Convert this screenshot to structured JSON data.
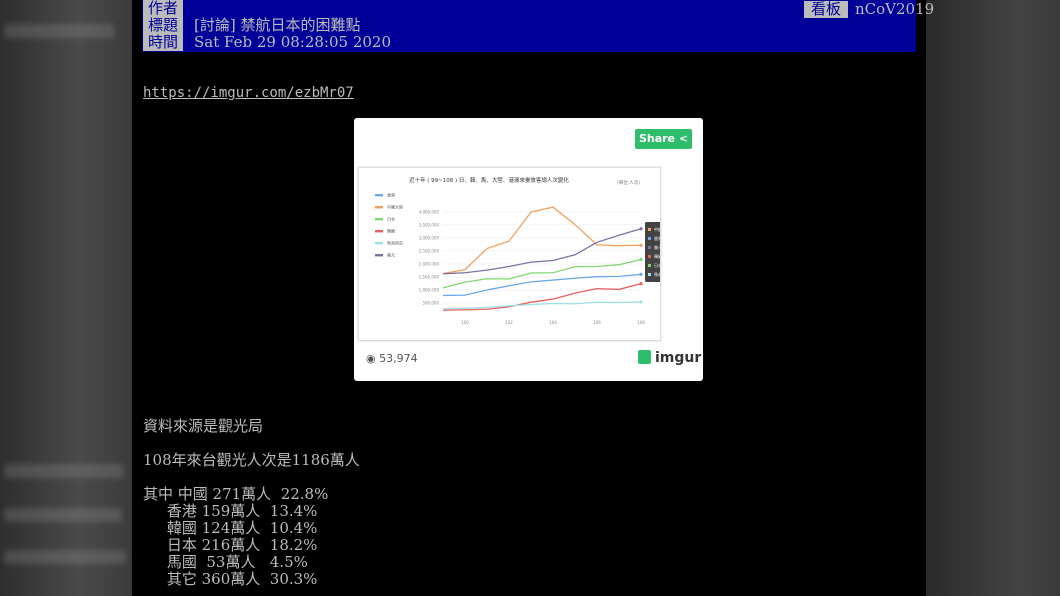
{
  "header": {
    "author_label": "作者",
    "title_label": "標題",
    "time_label": "時間",
    "title": "[討論] 禁航日本的困難點",
    "time": "Sat Feb 29 08:28:05 2020",
    "board_label": "看板",
    "board": "nCoV2019"
  },
  "link": "https://imgur.com/ezbMr07",
  "embed": {
    "share_label": "Share <",
    "views": "53,974",
    "brand": "imgur",
    "chart_data": {
      "type": "line",
      "title": "近十年 ( 99~108 ) 日、韓、馬、大陸、港澳來臺旅客總人次變化",
      "unit_note": "(單位:人次)",
      "x": [
        99,
        100,
        101,
        102,
        103,
        104,
        105,
        106,
        107,
        108
      ],
      "x_tick_labels": [
        "100",
        "102",
        "104",
        "106",
        "108"
      ],
      "y_tick_labels": [
        "500,000",
        "1,000,000",
        "1,500,000",
        "2,000,000",
        "2,500,000",
        "3,000,000",
        "3,500,000",
        "4,000,000"
      ],
      "ylim": [
        0,
        4300000
      ],
      "legend": [
        "香港",
        "中國大陸",
        "日本",
        "韓國",
        "馬來西亞",
        "美元"
      ],
      "series": [
        {
          "name": "中國大陸",
          "color": "#f0a060",
          "values": [
            1630000,
            1780000,
            2590000,
            2870000,
            3990000,
            4180000,
            3510000,
            2730000,
            2700000,
            2714065
          ]
        },
        {
          "name": "美元",
          "color": "#8070a0",
          "values": [
            1620000,
            1660000,
            1760000,
            1900000,
            2070000,
            2130000,
            2350000,
            2830000,
            3100000,
            3350000
          ]
        },
        {
          "name": "日本",
          "color": "#80d870",
          "values": [
            1080000,
            1300000,
            1430000,
            1420000,
            1650000,
            1660000,
            1890000,
            1900000,
            1970000,
            2167952
          ]
        },
        {
          "name": "香港",
          "color": "#6aa8e8",
          "values": [
            790000,
            800000,
            1000000,
            1160000,
            1310000,
            1380000,
            1450000,
            1510000,
            1520000,
            1598235
          ]
        },
        {
          "name": "韓國",
          "color": "#e86060",
          "values": [
            220000,
            240000,
            260000,
            350000,
            530000,
            650000,
            880000,
            1050000,
            1020000,
            1242598
          ]
        },
        {
          "name": "馬來西亞",
          "color": "#a0e0e8",
          "values": [
            280000,
            300000,
            330000,
            390000,
            440000,
            480000,
            470000,
            530000,
            520000,
            537692
          ]
        }
      ],
      "tooltip": [
        "中國大陸: 2,714,065",
        "香港: 1,598,235",
        "美元: 3,600,575",
        "韓國: 1,242,598",
        "日本: 2,167,952",
        "馬來西亞: 537,692"
      ]
    }
  },
  "body": {
    "line1": "資料來源是觀光局",
    "line2": "108年來台觀光人次是1186萬人",
    "stats": "其中 中國 271萬人  22.8%\n     香港 159萬人  13.4%\n     韓國 124萬人  10.4%\n     日本 216萬人  18.2%\n     馬國  53萬人   4.5%\n     其它 360萬人  30.3%"
  }
}
